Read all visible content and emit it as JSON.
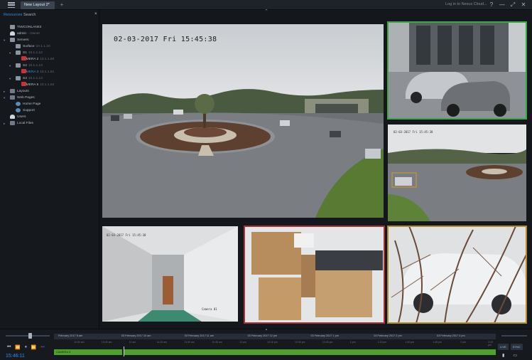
{
  "titlebar": {
    "layout_tab": "New Layout 2*",
    "add_tab": "+",
    "login_link": "Log in to Nexus Cloud...",
    "help_icon": "?",
    "minimize_icon": "—",
    "maximize_icon": "⤢",
    "close_icon": "✕"
  },
  "sidebar": {
    "tabs": [
      "Resources",
      "Search"
    ],
    "close_label": "×",
    "tree": [
      {
        "label": "TIWCONLAN03",
        "ip": "",
        "indent": 0,
        "icon": "server",
        "arrow": ""
      },
      {
        "label": "admin",
        "ip": "- Owner",
        "indent": 0,
        "icon": "person",
        "arrow": ""
      },
      {
        "label": "Servers",
        "ip": "",
        "indent": 0,
        "icon": "server",
        "arrow": "▾"
      },
      {
        "label": "Surface",
        "ip": "10.1.1.10",
        "indent": 1,
        "icon": "server",
        "arrow": ""
      },
      {
        "label": "S1",
        "ip": "10.1.1.12",
        "indent": 1,
        "icon": "server",
        "arrow": "▾"
      },
      {
        "label": "CAMERA 2",
        "ip": "10.1.1.60",
        "indent": 2,
        "icon": "cam",
        "arrow": ""
      },
      {
        "label": "S2",
        "ip": "10.1.1.13",
        "indent": 1,
        "icon": "server",
        "arrow": "▾"
      },
      {
        "label": "CAMERA 3",
        "ip": "10.1.1.61",
        "indent": 2,
        "icon": "cam",
        "arrow": "",
        "selected": true
      },
      {
        "label": "S3",
        "ip": "10.1.1.14",
        "indent": 1,
        "icon": "server",
        "arrow": "▾"
      },
      {
        "label": "CAMERA 5",
        "ip": "10.1.1.63",
        "indent": 2,
        "icon": "cam",
        "arrow": ""
      },
      {
        "label": "Layouts",
        "ip": "",
        "indent": 0,
        "icon": "folder",
        "arrow": "▸"
      },
      {
        "label": "Web Pages",
        "ip": "",
        "indent": 0,
        "icon": "folder",
        "arrow": "▾"
      },
      {
        "label": "Home Page",
        "ip": "",
        "indent": 1,
        "icon": "globe",
        "arrow": ""
      },
      {
        "label": "Support",
        "ip": "",
        "indent": 1,
        "icon": "globe",
        "arrow": ""
      },
      {
        "label": "Users",
        "ip": "",
        "indent": 0,
        "icon": "person",
        "arrow": ""
      },
      {
        "label": "Local Files",
        "ip": "",
        "indent": 0,
        "icon": "folder",
        "arrow": "▸"
      }
    ]
  },
  "cameras": {
    "main_osd": "02-03-2017 Fri 15:45:38",
    "right2_osd": "02-03-2017 Fri 15:45:38",
    "bottom1_osd": "02-03-2017 Fri 15:45:38",
    "bottom1_label": "Camera 01"
  },
  "timeline": {
    "days": [
      "February 2017 8 am",
      "03 February 2017 10 am",
      "03 February 2017 11 am",
      "03 February 2017 12 pm",
      "03 February 2017 1 pm",
      "03 February 2017 2 pm",
      "03 February 2017 3 pm"
    ],
    "hours": [
      "10:30 am",
      "10:45 am",
      "11 am",
      "11:15 am",
      "11:30 am",
      "11:45 am",
      "12 pm",
      "12:15 pm",
      "12:30 pm",
      "12:45 pm",
      "1 pm",
      "1:15 pm",
      "1:30 pm",
      "1:45 pm",
      "2 pm",
      "2:15 pm"
    ],
    "track_label": "CAMERA 3",
    "current_time": "15:46:11",
    "live_label": "LIVE",
    "sync_label": "SYNC"
  }
}
